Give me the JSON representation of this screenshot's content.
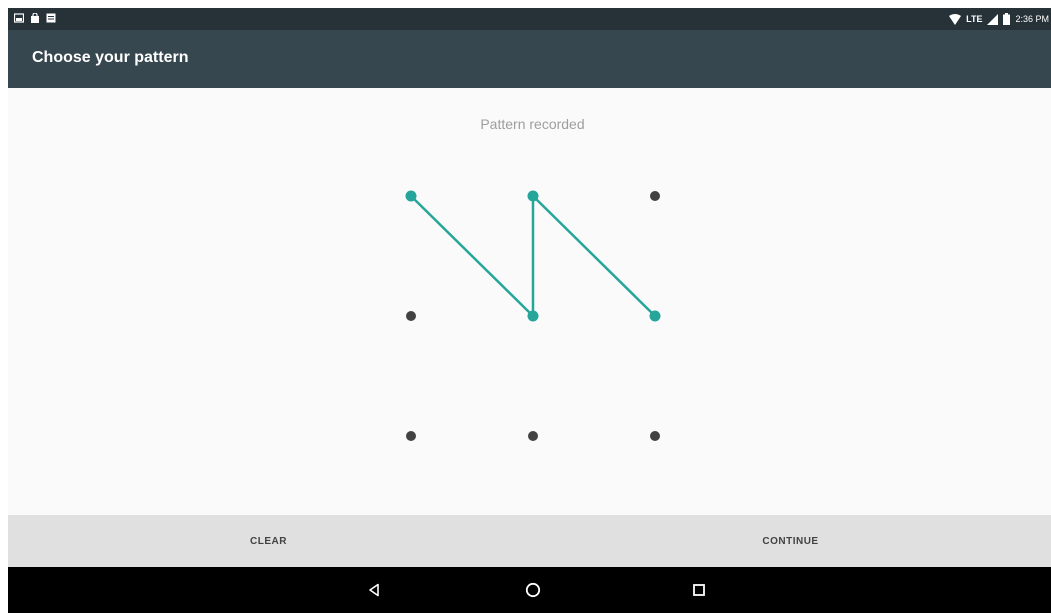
{
  "status_bar": {
    "network": "LTE",
    "time": "2:36 PM",
    "left_icons": [
      "screenshot-notification-icon",
      "shopping-bag-icon",
      "message-icon"
    ]
  },
  "app_bar": {
    "title": "Choose your pattern"
  },
  "content": {
    "message": "Pattern recorded",
    "pattern_sequence": [
      1,
      5,
      2,
      6
    ],
    "accent_color": "#26a69a",
    "dot_color": "#424242"
  },
  "buttons": {
    "clear": "CLEAR",
    "continue": "CONTINUE"
  },
  "nav": {
    "icons": [
      "back-icon",
      "home-icon",
      "recents-icon"
    ]
  }
}
